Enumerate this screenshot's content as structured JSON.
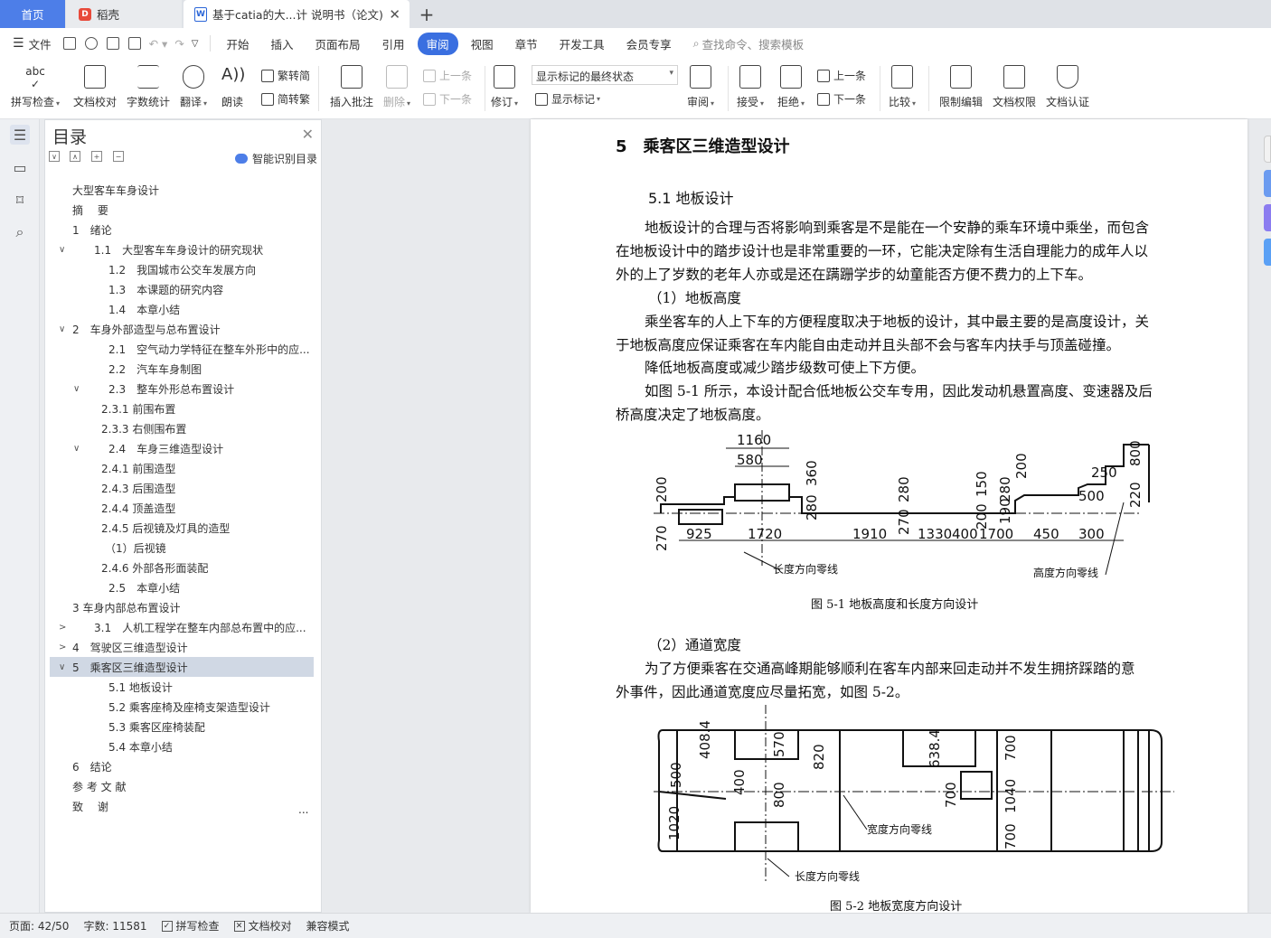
{
  "tabs": {
    "home": "首页",
    "daoke": "稻壳",
    "document": "基于catia的大...计 说明书（论文)"
  },
  "menubar": {
    "file": "文件",
    "items": [
      "开始",
      "插入",
      "页面布局",
      "引用",
      "审阅",
      "视图",
      "章节",
      "开发工具",
      "会员专享"
    ],
    "active": "审阅",
    "search_placeholder": "查找命令、搜索模板"
  },
  "ribbon": {
    "spell_check": "拼写检查",
    "doc_proof": "文档校对",
    "word_count": "字数统计",
    "translate": "翻译",
    "read_aloud": "朗读",
    "trad_simp": "繁转简",
    "simp_trad": "简转繁",
    "insert_comment": "插入批注",
    "delete": "删除",
    "prev_comment": "上一条",
    "next_comment": "下一条",
    "track_changes": "修订",
    "markup_select": "显示标记的最终状态",
    "show_markup": "显示标记",
    "review": "审阅",
    "accept": "接受",
    "reject": "拒绝",
    "prev_change": "上一条",
    "next_change": "下一条",
    "compare": "比较",
    "restrict_edit": "限制编辑",
    "doc_permission": "文档权限",
    "doc_certify": "文档认证"
  },
  "toc": {
    "title": "目录",
    "smart_label": "智能识别目录",
    "more": "...",
    "items": [
      {
        "text": "大型客车车身设计",
        "chev": ""
      },
      {
        "text": "摘　 要",
        "chev": ""
      },
      {
        "text": "1　绪论",
        "chev": ""
      },
      {
        "text": "1.1　大型客车车身设计的研究现状",
        "chev": "∨"
      },
      {
        "text": "1.2　我国城市公交车发展方向",
        "chev": ""
      },
      {
        "text": "1.3　本课题的研究内容",
        "chev": ""
      },
      {
        "text": "1.4　本章小结",
        "chev": ""
      },
      {
        "text": "2　车身外部造型与总布置设计",
        "chev": "∨"
      },
      {
        "text": "2.1　空气动力学特征在整车外形中的应...",
        "chev": ""
      },
      {
        "text": "2.2　汽车车身制图",
        "chev": ""
      },
      {
        "text": "2.3　整车外形总布置设计",
        "chev": "∨"
      },
      {
        "text": "2.3.1 前围布置",
        "chev": ""
      },
      {
        "text": "2.3.3 右侧围布置",
        "chev": ""
      },
      {
        "text": "2.4　车身三维造型设计",
        "chev": "∨"
      },
      {
        "text": "2.4.1  前围造型",
        "chev": ""
      },
      {
        "text": "2.4.3  后围造型",
        "chev": ""
      },
      {
        "text": "2.4.4  顶盖造型",
        "chev": ""
      },
      {
        "text": "2.4.5  后视镜及灯具的造型",
        "chev": ""
      },
      {
        "text": "（1）后视镜",
        "chev": ""
      },
      {
        "text": "2.4.6  外部各形面装配",
        "chev": ""
      },
      {
        "text": "2.5　本章小结",
        "chev": ""
      },
      {
        "text": "3 车身内部总布置设计",
        "chev": ""
      },
      {
        "text": "3.1　人机工程学在整车内部总布置中的应...",
        "chev": ">"
      },
      {
        "text": "4　驾驶区三维造型设计",
        "chev": ">"
      },
      {
        "text": "5　乘客区三维造型设计",
        "chev": "∨"
      },
      {
        "text": "5.1  地板设计",
        "chev": ""
      },
      {
        "text": "5.2  乘客座椅及座椅支架造型设计",
        "chev": ""
      },
      {
        "text": "5.3  乘客区座椅装配",
        "chev": ""
      },
      {
        "text": "5.4  本章小结",
        "chev": ""
      },
      {
        "text": "6　结论",
        "chev": ""
      },
      {
        "text": "参 考 文 献",
        "chev": ""
      },
      {
        "text": "致　 谢",
        "chev": ""
      }
    ]
  },
  "document": {
    "heading": "5　乘客区三维造型设计",
    "subheading": "5.1  地板设计",
    "lines": [
      "地板设计的合理与否将影响到乘客是不是能在一个安静的乘车环境中乘坐，而包含",
      "在地板设计中的踏步设计也是非常重要的一环，它能决定除有生活自理能力的成年人以",
      "外的上了岁数的老年人亦或是还在蹒跚学步的幼童能否方便不费力的上下车。",
      "（1）地板高度",
      "乘坐客车的人上下车的方便程度取决于地板的设计，其中最主要的是高度设计，关",
      "于地板高度应保证乘客在车内能自由走动并且头部不会与客车内扶手与顶盖碰撞。",
      "降低地板高度或减少踏步级数可使上下方便。",
      "如图 5-1 所示，本设计配合低地板公交车专用，因此发动机悬置高度、变速器及后",
      "桥高度决定了地板高度。"
    ],
    "fig1_caption": "图 5-1  地板高度和长度方向设计",
    "fig1_labels": {
      "d1160": "1160",
      "d580": "580",
      "d360": "360",
      "d200a": "200",
      "d270": "270",
      "d925": "925",
      "d1720": "1720",
      "d280a": "280",
      "d1910": "1910",
      "d280b": "280",
      "d270b": "270",
      "d1330": "1330",
      "d400": "400",
      "d150": "150",
      "d200b": "200",
      "d280c": "280",
      "d190": "190",
      "d1700": "1700",
      "d450": "450",
      "d200c": "200",
      "d250": "250",
      "d500": "500",
      "d300": "300",
      "d800": "800",
      "d220": "220",
      "len_zero": "长度方向零线",
      "h_zero": "高度方向零线"
    },
    "lines2": [
      "（2）通道宽度",
      "为了方便乘客在交通高峰期能够顺利在客车内部来回走动并不发生拥挤踩踏的意",
      "外事件，因此通道宽度应尽量拓宽，如图 5-2。"
    ],
    "fig2_caption": "图 5-2  地板宽度方向设计",
    "fig2_labels": {
      "w1020": "1020",
      "w500": "500",
      "w408": "408.4",
      "w400": "400",
      "w570": "570",
      "w800": "800",
      "w820": "820",
      "w638": "638.4",
      "w700a": "700",
      "w700b": "700",
      "w1040": "1040",
      "w700c": "700",
      "width_zero": "宽度方向零线",
      "len_zero": "长度方向零线"
    }
  },
  "status": {
    "page": "页面: 42/50",
    "words": "字数: 11581",
    "spell": "拼写检查",
    "proof": "文档校对",
    "compat": "兼容模式"
  }
}
